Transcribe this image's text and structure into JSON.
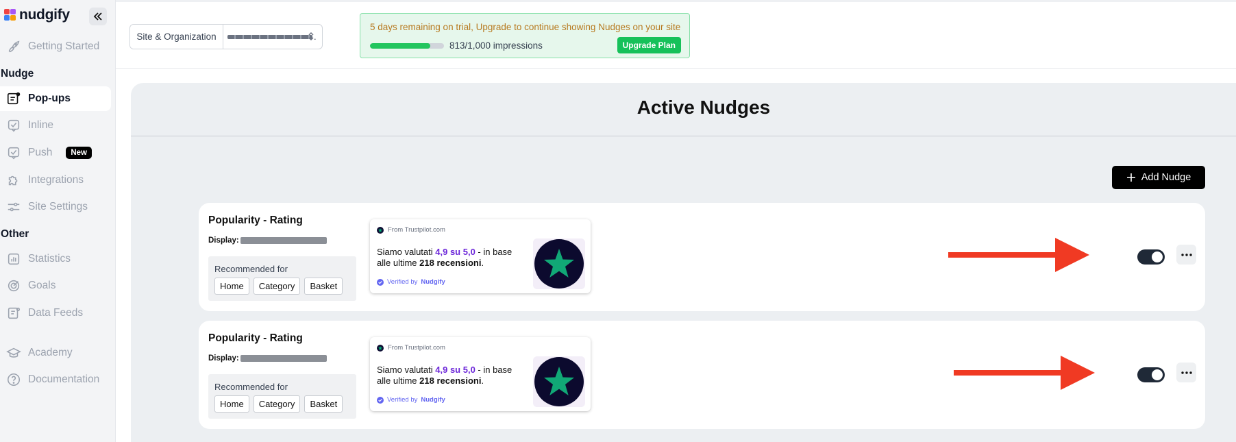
{
  "brand": {
    "name": "nudgify"
  },
  "sidebar": {
    "collapse_icon": "chevrons-left-icon",
    "items": [
      {
        "label": "Getting Started",
        "icon": "rocket-icon"
      },
      {
        "label": "Pop-ups",
        "icon": "popup-icon",
        "active": true
      },
      {
        "label": "Inline",
        "icon": "inline-check-icon"
      },
      {
        "label": "Push",
        "icon": "push-check-icon",
        "badge": "New"
      },
      {
        "label": "Integrations",
        "icon": "puzzle-icon"
      },
      {
        "label": "Site Settings",
        "icon": "sliders-icon"
      },
      {
        "label": "Statistics",
        "icon": "bar-chart-icon"
      },
      {
        "label": "Goals",
        "icon": "target-icon"
      },
      {
        "label": "Data Feeds",
        "icon": "data-feed-icon"
      },
      {
        "label": "Academy",
        "icon": "graduation-cap-icon"
      },
      {
        "label": "Documentation",
        "icon": "help-circle-icon"
      }
    ],
    "sections": {
      "nudge": "Nudge",
      "other": "Other"
    }
  },
  "topbar": {
    "site_select": {
      "label": "Site & Organization",
      "value_suffix": "."
    },
    "trial": {
      "message": "5 days remaining on trial, Upgrade to continue showing Nudges on your site",
      "impressions_text": "813/1,000 impressions",
      "impressions_used": 813,
      "impressions_total": 1000,
      "upgrade_label": "Upgrade Plan"
    }
  },
  "main": {
    "title": "Active Nudges",
    "add_label": "Add Nudge",
    "nudges": [
      {
        "title": "Popularity - Rating",
        "display_label": "Display:",
        "recommended_label": "Recommended for",
        "tags": [
          "Home",
          "Category",
          "Basket"
        ],
        "preview": {
          "source": "From Trustpilot.com",
          "text_pre": "Siamo valutati ",
          "rating": "4,9 su 5,0",
          "text_mid": " - in base alle ultime ",
          "reviews": "218 recensioni",
          "text_post": ".",
          "verified_pre": "Verified by ",
          "verified_brand": "Nudgify"
        },
        "enabled": true
      },
      {
        "title": "Popularity - Rating",
        "display_label": "Display:",
        "recommended_label": "Recommended for",
        "tags": [
          "Home",
          "Category",
          "Basket"
        ],
        "preview": {
          "source": "From Trustpilot.com",
          "text_pre": "Siamo valutati ",
          "rating": "4,9 su 5,0",
          "text_mid": " - in base alle ultime ",
          "reviews": "218 recensioni",
          "text_post": ".",
          "verified_pre": "Verified by ",
          "verified_brand": "Nudgify"
        },
        "enabled": true
      }
    ]
  },
  "colors": {
    "accent_green": "#16c15a",
    "arrow_red": "#f03a23",
    "toggle_on": "#1f2937",
    "rating_purple": "#6d28d9",
    "trustpilot_green": "#00b67a"
  }
}
